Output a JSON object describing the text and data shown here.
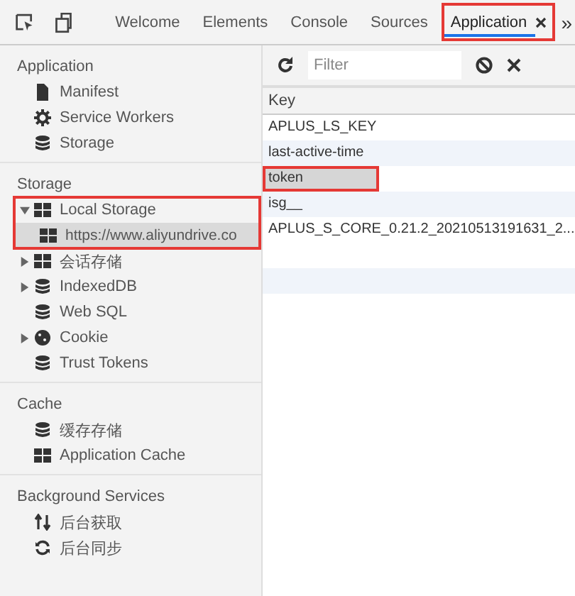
{
  "tabs": [
    {
      "label": "Welcome",
      "selected": false,
      "closable": false,
      "annotated": false
    },
    {
      "label": "Elements",
      "selected": false,
      "closable": false,
      "annotated": false
    },
    {
      "label": "Console",
      "selected": false,
      "closable": false,
      "annotated": false
    },
    {
      "label": "Sources",
      "selected": false,
      "closable": false,
      "annotated": false
    },
    {
      "label": "Application",
      "selected": true,
      "closable": true,
      "annotated": true
    }
  ],
  "more_tabs": "»",
  "sidebar": {
    "sections": [
      {
        "title": "Application",
        "items": [
          {
            "label": "Manifest",
            "kind": "file",
            "selected": false
          },
          {
            "label": "Service Workers",
            "kind": "gear",
            "selected": false
          },
          {
            "label": "Storage",
            "kind": "database",
            "selected": false
          }
        ]
      },
      {
        "title": "Storage",
        "items": [
          {
            "label": "Local Storage",
            "kind": "grid",
            "selected": false,
            "expanded": true,
            "annotated": true,
            "children": [
              {
                "label": "https://www.aliyundrive.co",
                "kind": "grid",
                "selected": true
              }
            ]
          },
          {
            "label": "会话存储",
            "kind": "grid",
            "selected": false,
            "expanded": false
          },
          {
            "label": "IndexedDB",
            "kind": "database",
            "selected": false,
            "expanded": false
          },
          {
            "label": "Web SQL",
            "kind": "database",
            "selected": false
          },
          {
            "label": "Cookie",
            "kind": "cookie",
            "selected": false,
            "expanded": false
          },
          {
            "label": "Trust Tokens",
            "kind": "database",
            "selected": false
          }
        ]
      },
      {
        "title": "Cache",
        "items": [
          {
            "label": "缓存存储",
            "kind": "database",
            "selected": false
          },
          {
            "label": "Application Cache",
            "kind": "grid",
            "selected": false
          }
        ]
      },
      {
        "title": "Background Services",
        "items": [
          {
            "label": "后台获取",
            "kind": "arrows",
            "selected": false
          },
          {
            "label": "后台同步",
            "kind": "sync",
            "selected": false
          }
        ]
      }
    ]
  },
  "filter": {
    "placeholder": "Filter"
  },
  "table": {
    "columns": [
      "Key"
    ],
    "rows": [
      {
        "key": "APLUS_LS_KEY",
        "selected": false,
        "annotated": false
      },
      {
        "key": "last-active-time",
        "selected": false,
        "annotated": false
      },
      {
        "key": "token",
        "selected": true,
        "annotated": true
      },
      {
        "key": "isg__",
        "selected": false,
        "annotated": false
      },
      {
        "key": "APLUS_S_CORE_0.21.2_20210513191631_2...",
        "selected": false,
        "annotated": false
      }
    ]
  }
}
